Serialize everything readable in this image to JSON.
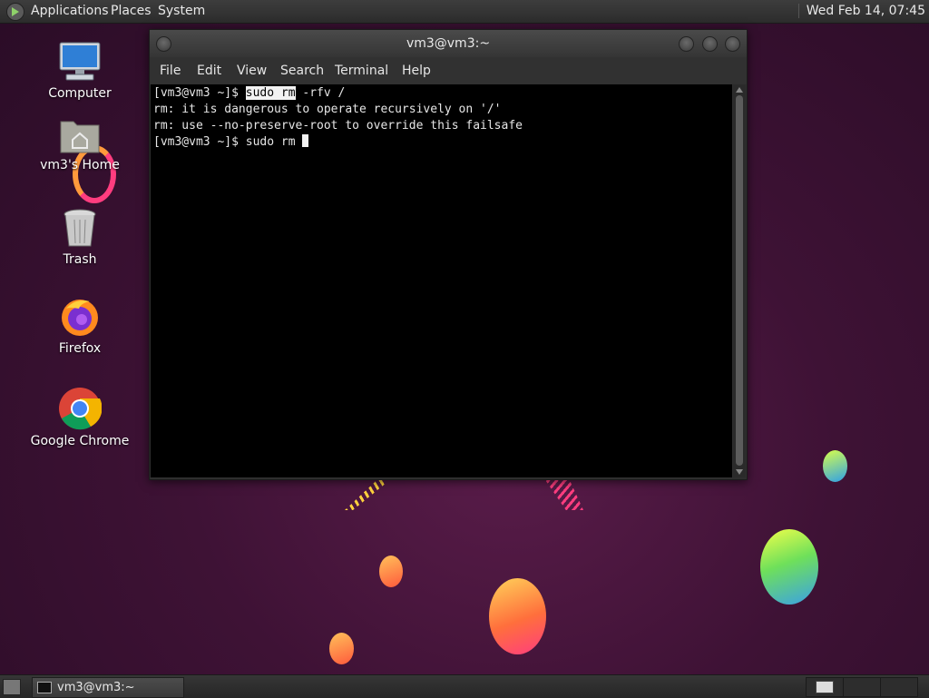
{
  "top_panel": {
    "menus": [
      "Applications",
      "Places",
      "System"
    ],
    "clock": "Wed Feb 14, 07:45"
  },
  "desktop_icons": [
    {
      "label": "Computer",
      "icon": "computer-icon"
    },
    {
      "label": "vm3's Home",
      "icon": "home-folder-icon"
    },
    {
      "label": "Trash",
      "icon": "trash-icon"
    },
    {
      "label": "Firefox",
      "icon": "firefox-icon"
    },
    {
      "label": "Google Chrome",
      "icon": "chrome-icon"
    }
  ],
  "terminal": {
    "title": "vm3@vm3:~",
    "menu": [
      "File",
      "Edit",
      "View",
      "Search",
      "Terminal",
      "Help"
    ],
    "lines": [
      {
        "prompt": "[vm3@vm3 ~]$ ",
        "selected": "sudo rm",
        "rest": " -rfv /"
      },
      {
        "text": "rm: it is dangerous to operate recursively on '/'"
      },
      {
        "text": "rm: use --no-preserve-root to override this failsafe"
      },
      {
        "prompt": "[vm3@vm3 ~]$ ",
        "rest": "sudo rm "
      }
    ]
  },
  "bottom_panel": {
    "task_label": "vm3@vm3:~"
  },
  "colors": {
    "desktop_bg": "#3e1235",
    "panel_bg": "#2c2c2c",
    "terminal_bg": "#000000",
    "terminal_fg": "#e6e6e6"
  }
}
